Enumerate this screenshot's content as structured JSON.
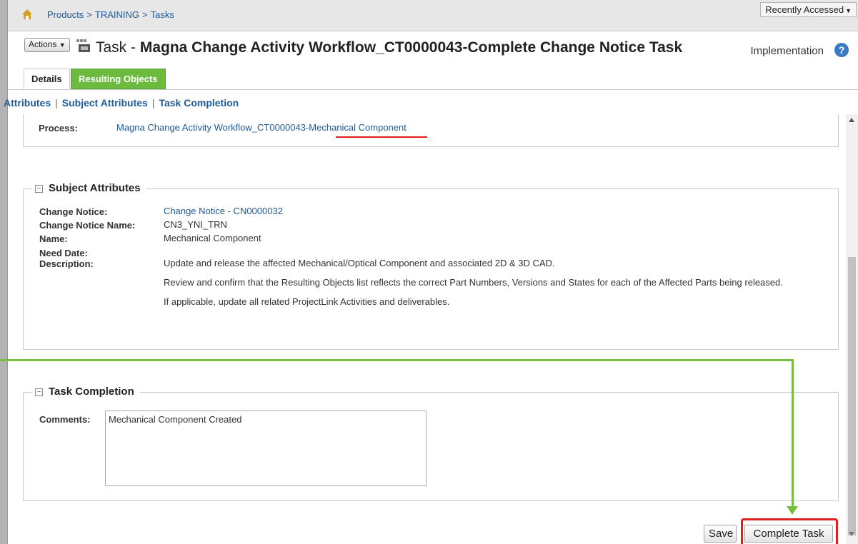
{
  "breadcrumb": {
    "items": [
      "Products",
      "TRAINING",
      "Tasks"
    ],
    "separator": ">"
  },
  "recently_accessed": {
    "label": "Recently Accessed"
  },
  "header": {
    "actions_label": "Actions",
    "title_prefix": "Task - ",
    "title_name": "Magna Change Activity Workflow_CT0000043-Complete Change Notice Task",
    "context": "Implementation"
  },
  "tabs": [
    {
      "label": "Details",
      "active": true
    },
    {
      "label": "Resulting Objects",
      "active": false
    }
  ],
  "anchors": [
    "Attributes",
    "Subject Attributes",
    "Task Completion"
  ],
  "process": {
    "label": "Process:",
    "value": "Magna Change Activity Workflow_CT0000043-Mechanical Component"
  },
  "subject_attributes": {
    "title": "Subject Attributes",
    "change_notice_label": "Change Notice:",
    "change_notice_value": "Change Notice - CN0000032",
    "change_notice_name_label": "Change Notice Name:",
    "change_notice_name_value": "CN3_YNI_TRN",
    "name_label": "Name:",
    "name_value": "Mechanical Component",
    "need_date_label": "Need Date:",
    "need_date_value": "",
    "description_label": "Description:",
    "description_line1": "Update and release the affected Mechanical/Optical Component and associated 2D & 3D CAD.",
    "description_line2": "Review and confirm that the Resulting Objects list reflects the correct Part Numbers, Versions and States for each of the Affected Parts being released.",
    "description_line3": "If applicable, update all related ProjectLink Activities and deliverables."
  },
  "task_completion": {
    "title": "Task Completion",
    "comments_label": "Comments:",
    "comments_value": "Mechanical Component Created"
  },
  "buttons": {
    "save": "Save",
    "complete_task": "Complete Task"
  },
  "colors": {
    "link": "#1f5a96",
    "accent_green": "#6cba3e",
    "annotation_green": "#79bf3f",
    "annotation_red": "#e21d1d"
  },
  "icons": [
    "home-icon",
    "task-icon",
    "help-icon",
    "collapse-icon",
    "chevron-down-icon"
  ]
}
